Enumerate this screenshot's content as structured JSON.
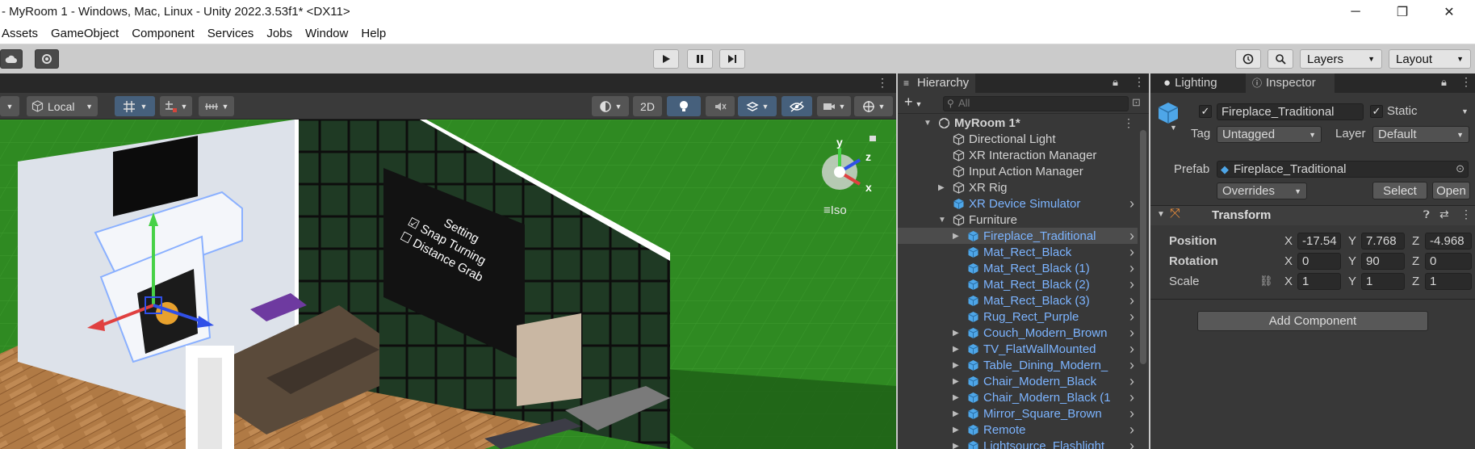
{
  "window": {
    "title": "- MyRoom 1 - Windows, Mac, Linux - Unity 2022.3.53f1* <DX11>",
    "minimize": "─",
    "restore": "❐",
    "close": "✕"
  },
  "menu": [
    "Assets",
    "GameObject",
    "Component",
    "Services",
    "Jobs",
    "Window",
    "Help"
  ],
  "toolbar": {
    "layers": "Layers",
    "layout": "Layout"
  },
  "scene": {
    "pivot_mode": "Local",
    "mode_2d": "2D",
    "gizmo_y": "y",
    "gizmo_z": "z",
    "gizmo_x": "x",
    "iso_label": "Iso",
    "panel_items": [
      "Setting",
      "Snap Turning",
      "Distance Grab"
    ]
  },
  "hierarchy": {
    "tab": "Hierarchy",
    "search_placeholder": "All",
    "rows": [
      {
        "label": "MyRoom 1*",
        "indent": 0,
        "type": "scene",
        "fold": "open"
      },
      {
        "label": "Directional Light",
        "indent": 1,
        "type": "gray"
      },
      {
        "label": "XR Interaction Manager",
        "indent": 1,
        "type": "gray"
      },
      {
        "label": "Input Action Manager",
        "indent": 1,
        "type": "gray"
      },
      {
        "label": "XR Rig",
        "indent": 1,
        "type": "gray",
        "fold": "closed"
      },
      {
        "label": "XR Device Simulator",
        "indent": 1,
        "type": "blue",
        "chev": true
      },
      {
        "label": "Furniture",
        "indent": 1,
        "type": "gray",
        "fold": "open"
      },
      {
        "label": "Fireplace_Traditional",
        "indent": 2,
        "type": "blue",
        "fold": "closed",
        "chev": true,
        "selected": true
      },
      {
        "label": "Mat_Rect_Black",
        "indent": 2,
        "type": "blue",
        "chev": true
      },
      {
        "label": "Mat_Rect_Black (1)",
        "indent": 2,
        "type": "blue",
        "chev": true
      },
      {
        "label": "Mat_Rect_Black (2)",
        "indent": 2,
        "type": "blue",
        "chev": true
      },
      {
        "label": "Mat_Rect_Black (3)",
        "indent": 2,
        "type": "blue",
        "chev": true
      },
      {
        "label": "Rug_Rect_Purple",
        "indent": 2,
        "type": "blue",
        "chev": true
      },
      {
        "label": "Couch_Modern_Brown",
        "indent": 2,
        "type": "blue",
        "fold": "closed",
        "chev": true
      },
      {
        "label": "TV_FlatWallMounted",
        "indent": 2,
        "type": "blue",
        "fold": "closed",
        "chev": true
      },
      {
        "label": "Table_Dining_Modern_",
        "indent": 2,
        "type": "blue",
        "fold": "closed",
        "chev": true
      },
      {
        "label": "Chair_Modern_Black",
        "indent": 2,
        "type": "blue",
        "fold": "closed",
        "chev": true
      },
      {
        "label": "Chair_Modern_Black (1",
        "indent": 2,
        "type": "blue",
        "fold": "closed",
        "chev": true
      },
      {
        "label": "Mirror_Square_Brown",
        "indent": 2,
        "type": "blue",
        "fold": "closed",
        "chev": true
      },
      {
        "label": "Remote",
        "indent": 2,
        "type": "blue",
        "fold": "closed",
        "chev": true
      },
      {
        "label": "Lightsource_Flashlight",
        "indent": 2,
        "type": "blue",
        "fold": "closed",
        "chev": true
      }
    ]
  },
  "inspector": {
    "tab_lighting": "Lighting",
    "tab_inspector": "Inspector",
    "object_name": "Fireplace_Traditional",
    "static_label": "Static",
    "tag_label": "Tag",
    "tag_value": "Untagged",
    "layer_label": "Layer",
    "layer_value": "Default",
    "prefab_label": "Prefab",
    "prefab_value": "Fireplace_Traditional",
    "overrides": "Overrides",
    "select": "Select",
    "open": "Open",
    "transform": {
      "title": "Transform",
      "position_label": "Position",
      "rotation_label": "Rotation",
      "scale_label": "Scale",
      "axis_x": "X",
      "axis_y": "Y",
      "axis_z": "Z",
      "position": {
        "x": "-17.54",
        "y": "7.768",
        "z": "-4.968"
      },
      "rotation": {
        "x": "0",
        "y": "90",
        "z": "0"
      },
      "scale": {
        "x": "1",
        "y": "1",
        "z": "1"
      }
    },
    "add_component": "Add Component"
  },
  "colors": {
    "prefab_blue": "#7cb4ff",
    "scene_green": "#2f8a22",
    "panel_dark": "#383838"
  }
}
